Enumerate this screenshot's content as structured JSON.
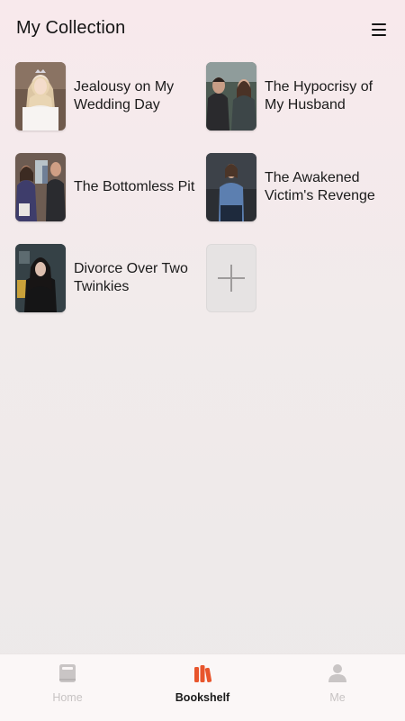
{
  "header": {
    "title": "My Collection"
  },
  "books": [
    {
      "title": "Jealousy on My Wedding Day"
    },
    {
      "title": "The Hypocrisy of My Husband"
    },
    {
      "title": "The Bottomless Pit"
    },
    {
      "title": "The Awakened Victim's Revenge"
    },
    {
      "title": "Divorce Over Two Twinkies"
    }
  ],
  "tabbar": {
    "tabs": [
      {
        "label": "Home",
        "icon": "book-icon",
        "active": false
      },
      {
        "label": "Bookshelf",
        "icon": "bookshelf-icon",
        "active": true
      },
      {
        "label": "Me",
        "icon": "person-icon",
        "active": false
      }
    ]
  },
  "colors": {
    "accent": "#e8552c",
    "inactive": "#c7c3c3",
    "text": "#141414"
  }
}
